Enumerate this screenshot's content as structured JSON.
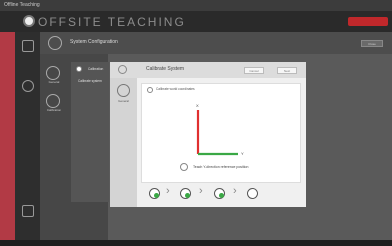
{
  "window": {
    "title": "Offline Teaching"
  },
  "app": {
    "name": "OFFSITE TEACHING"
  },
  "header": {
    "title": "System Configuration",
    "button_label": "Close"
  },
  "left_panel": {
    "items": [
      {
        "label": "General"
      },
      {
        "label": "Calibration"
      }
    ]
  },
  "menu": {
    "items": [
      {
        "label": "Calibration"
      },
      {
        "label": "Calibrate system"
      }
    ]
  },
  "dialog": {
    "title": "Calibrate System",
    "cancel_label": "Cancel",
    "next_label": "Next",
    "left_label": "General",
    "step_label": "Calibrate world coordinates",
    "axis_x": "X",
    "axis_y": "Y",
    "teach_label": "Teach Y-direction reference position"
  },
  "colors": {
    "accent_red": "#b23a45",
    "x_axis": "#e03030",
    "y_axis": "#3aa845",
    "step_done": "#3aa845"
  }
}
